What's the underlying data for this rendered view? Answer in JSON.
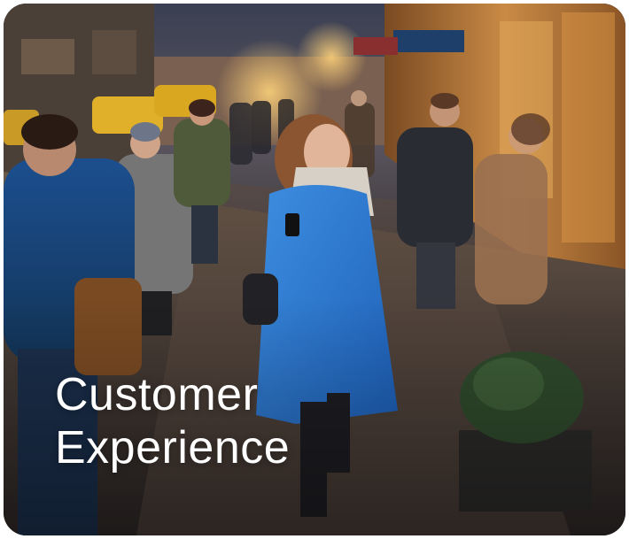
{
  "card": {
    "title_line1": "Customer",
    "title_line2": "Experience"
  },
  "photo": {
    "icon": "street-scene-photo"
  }
}
